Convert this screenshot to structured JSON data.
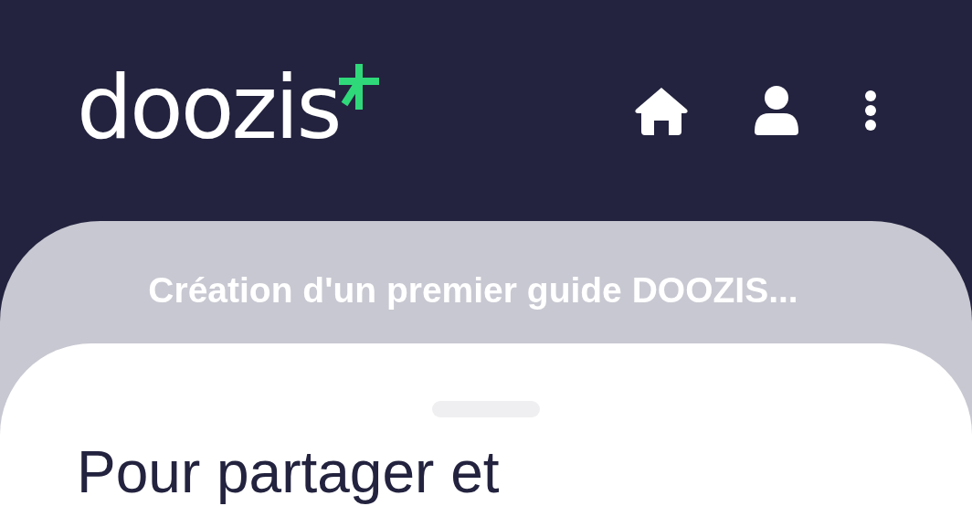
{
  "header": {
    "logo": "doozis"
  },
  "guide": {
    "title": "Création d'un premier guide DOOZIS..."
  },
  "sheet": {
    "heading": "Pour partager et"
  }
}
